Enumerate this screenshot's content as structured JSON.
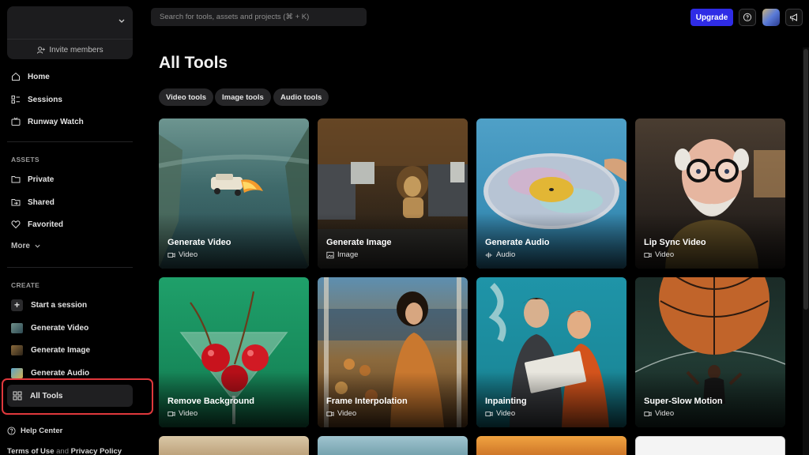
{
  "sidebar": {
    "invite_label": "Invite members",
    "nav": [
      {
        "label": "Home",
        "icon": "home-icon"
      },
      {
        "label": "Sessions",
        "icon": "sessions-icon"
      },
      {
        "label": "Runway Watch",
        "icon": "tv-icon"
      }
    ],
    "assets_heading": "ASSETS",
    "assets": [
      {
        "label": "Private",
        "icon": "folder-icon"
      },
      {
        "label": "Shared",
        "icon": "shared-folder-icon"
      },
      {
        "label": "Favorited",
        "icon": "heart-icon"
      }
    ],
    "more_label": "More",
    "create_heading": "CREATE",
    "create": [
      {
        "label": "Start a session"
      },
      {
        "label": "Generate Video"
      },
      {
        "label": "Generate Image"
      },
      {
        "label": "Generate Audio"
      },
      {
        "label": "All Tools"
      }
    ],
    "help_center": "Help Center",
    "terms_of_use": "Terms of Use",
    "and": "and",
    "privacy_policy": "Privacy Policy"
  },
  "topbar": {
    "search_placeholder": "Search for tools, assets and projects (⌘ + K)",
    "upgrade_label": "Upgrade"
  },
  "main": {
    "title": "All Tools",
    "filters": [
      "Video tools",
      "Image tools",
      "Audio tools"
    ],
    "tools": [
      {
        "title": "Generate Video",
        "type": "Video"
      },
      {
        "title": "Generate Image",
        "type": "Image"
      },
      {
        "title": "Generate Audio",
        "type": "Audio"
      },
      {
        "title": "Lip Sync Video",
        "type": "Video"
      },
      {
        "title": "Remove Background",
        "type": "Video"
      },
      {
        "title": "Frame Interpolation",
        "type": "Video"
      },
      {
        "title": "Inpainting",
        "type": "Video"
      },
      {
        "title": "Super-Slow Motion",
        "type": "Video"
      }
    ]
  },
  "colors": {
    "accent": "#2f2ce6",
    "highlight": "#e0383c",
    "background": "#000000"
  }
}
